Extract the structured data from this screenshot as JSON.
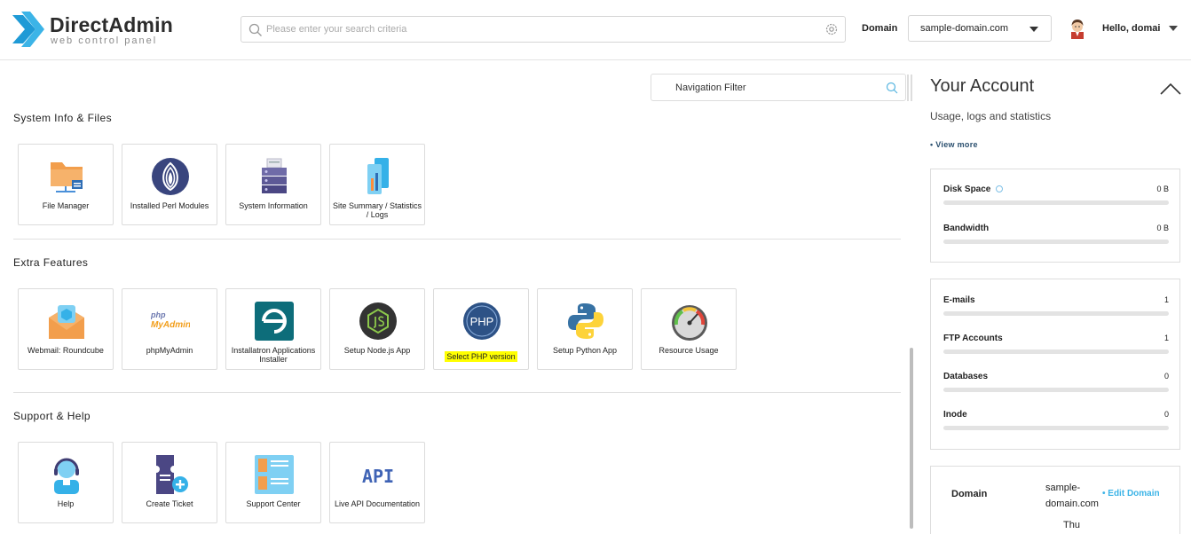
{
  "header": {
    "logo_title": "DirectAdmin",
    "logo_subtitle": "web control panel",
    "search_placeholder": "Please enter your search criteria",
    "domain_label": "Domain",
    "domain_selected": "sample-domain.com",
    "greeting": "Hello, domai"
  },
  "main": {
    "nav_filter_value": "Navigation Filter",
    "sections": [
      {
        "title": "System Info & Files",
        "items": [
          {
            "label": "File Manager",
            "icon": "folder-icon"
          },
          {
            "label": "Installed Perl Modules",
            "icon": "perl-onion-icon"
          },
          {
            "label": "System Information",
            "icon": "server-icon"
          },
          {
            "label": "Site Summary / Statistics / Logs",
            "icon": "statistics-icon"
          }
        ]
      },
      {
        "title": "Extra Features",
        "items": [
          {
            "label": "Webmail: Roundcube",
            "icon": "roundcube-mail-icon"
          },
          {
            "label": "phpMyAdmin",
            "icon": "phpmyadmin-icon",
            "logo_text_1": "php",
            "logo_text_2": "MyAdmin"
          },
          {
            "label": "Installatron Applications Installer",
            "icon": "installatron-icon"
          },
          {
            "label": "Setup Node.js App",
            "icon": "nodejs-icon"
          },
          {
            "label": "Select PHP version",
            "icon": "php-icon",
            "logo_text": "PHP",
            "highlighted": true
          },
          {
            "label": "Setup Python App",
            "icon": "python-icon"
          },
          {
            "label": "Resource Usage",
            "icon": "gauge-icon"
          }
        ]
      },
      {
        "title": "Support & Help",
        "items": [
          {
            "label": "Help",
            "icon": "support-agent-icon"
          },
          {
            "label": "Create Ticket",
            "icon": "ticket-icon"
          },
          {
            "label": "Support Center",
            "icon": "support-center-icon"
          },
          {
            "label": "Live API Documentation",
            "icon": "api-icon",
            "logo_text": "API"
          }
        ]
      }
    ]
  },
  "account": {
    "title": "Your Account",
    "subtitle": "Usage, logs and statistics",
    "view_more": "• View more",
    "usage": [
      {
        "label": "Disk Space",
        "value": "0 B",
        "fraction": 0
      },
      {
        "label": "Bandwidth",
        "value": "0 B",
        "fraction": 0
      }
    ],
    "counts": [
      {
        "label": "E-mails",
        "value": "1",
        "fraction": 0
      },
      {
        "label": "FTP Accounts",
        "value": "1",
        "fraction": 0
      },
      {
        "label": "Databases",
        "value": "0",
        "fraction": 0
      },
      {
        "label": "Inode",
        "value": "0",
        "fraction": 0
      }
    ],
    "domain_card": {
      "label": "Domain",
      "value": "sample-domain.com",
      "edit_label": "• Edit Domain",
      "next_value": "Thu"
    }
  },
  "colors": {
    "accent": "#3cb4e7",
    "highlight": "#ffff00",
    "logo_blue": "#1f9ad6"
  }
}
